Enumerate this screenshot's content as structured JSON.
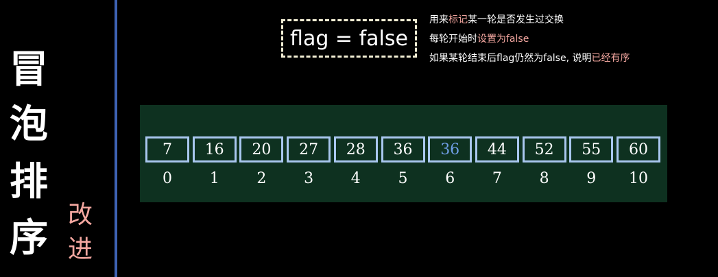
{
  "title": [
    "冒",
    "泡",
    "排",
    "序"
  ],
  "subtitle": [
    "改",
    "进"
  ],
  "flag_expr": "flag = false",
  "notes": [
    [
      {
        "text": "用来",
        "hl": false
      },
      {
        "text": "标记",
        "hl": true
      },
      {
        "text": "某一轮是否发生过交换",
        "hl": false
      }
    ],
    [
      {
        "text": "每轮开始时",
        "hl": false
      },
      {
        "text": "设置为false",
        "hl": true
      }
    ],
    [
      {
        "text": "如果某轮结束后flag仍然为false, 说明",
        "hl": false
      },
      {
        "text": "已经有序",
        "hl": true
      }
    ]
  ],
  "array": {
    "values": [
      "7",
      "16",
      "20",
      "27",
      "28",
      "36",
      "36",
      "44",
      "52",
      "55",
      "60"
    ],
    "indices": [
      "0",
      "1",
      "2",
      "3",
      "4",
      "5",
      "6",
      "7",
      "8",
      "9",
      "10"
    ],
    "highlighted": [
      6
    ]
  },
  "colors": {
    "background": "#000000",
    "divider": "#3e63b4",
    "highlight_text": "#f4a7a0",
    "panel": "#0e3120",
    "cell_border": "#a9c7ef",
    "highlight_value": "#6f9ee6"
  }
}
